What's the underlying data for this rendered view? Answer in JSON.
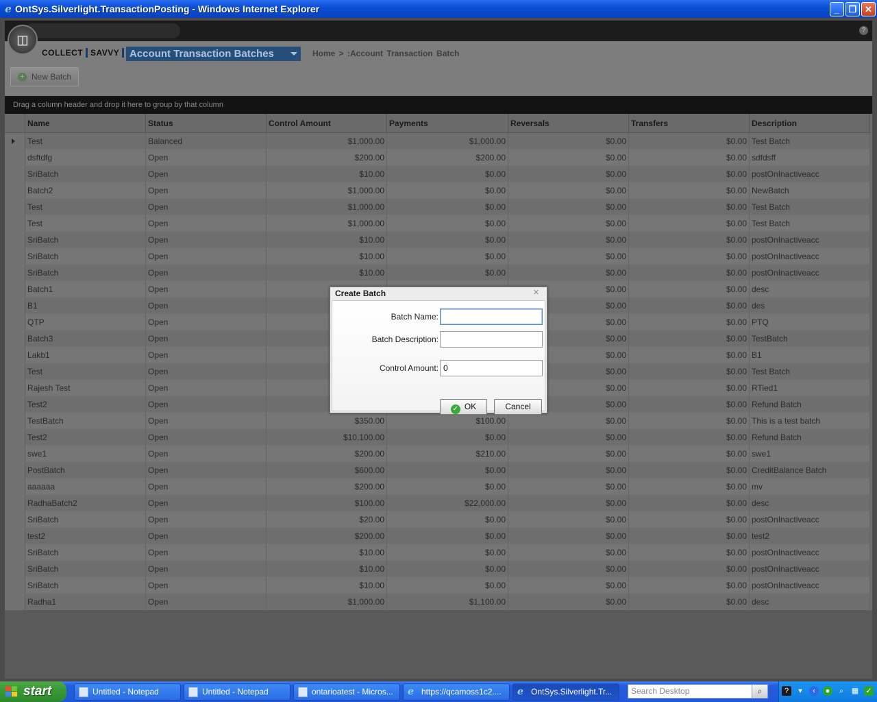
{
  "window": {
    "title": "OntSys.Silverlight.TransactionPosting - Windows Internet Explorer"
  },
  "app": {
    "brand_collect": "COLLECT",
    "brand_savvy": "SAVVY",
    "menu_title": "Account Transaction Batches",
    "breadcrumb": "Home  >  :Account Transaction Batch",
    "new_batch_label": "New Batch",
    "group_hint": "Drag a column header and drop it here to group by that column"
  },
  "grid": {
    "columns": [
      "Name",
      "Status",
      "Control Amount",
      "Payments",
      "Reversals",
      "Transfers",
      "Description"
    ],
    "rows": [
      [
        "Test",
        "Balanced",
        "$1,000.00",
        "$1,000.00",
        "$0.00",
        "$0.00",
        "Test Batch"
      ],
      [
        "dsftdfg",
        "Open",
        "$200.00",
        "$200.00",
        "$0.00",
        "$0.00",
        "sdfdsff"
      ],
      [
        "SriBatch",
        "Open",
        "$10.00",
        "$0.00",
        "$0.00",
        "$0.00",
        "postOnInactiveacc"
      ],
      [
        "Batch2",
        "Open",
        "$1,000.00",
        "$0.00",
        "$0.00",
        "$0.00",
        "NewBatch"
      ],
      [
        "Test",
        "Open",
        "$1,000.00",
        "$0.00",
        "$0.00",
        "$0.00",
        "Test Batch"
      ],
      [
        "Test",
        "Open",
        "$1,000.00",
        "$0.00",
        "$0.00",
        "$0.00",
        "Test Batch"
      ],
      [
        "SriBatch",
        "Open",
        "$10.00",
        "$0.00",
        "$0.00",
        "$0.00",
        "postOnInactiveacc"
      ],
      [
        "SriBatch",
        "Open",
        "$10.00",
        "$0.00",
        "$0.00",
        "$0.00",
        "postOnInactiveacc"
      ],
      [
        "SriBatch",
        "Open",
        "$10.00",
        "$0.00",
        "$0.00",
        "$0.00",
        "postOnInactiveacc"
      ],
      [
        "Batch1",
        "Open",
        "",
        "",
        "$0.00",
        "$0.00",
        "desc"
      ],
      [
        "B1",
        "Open",
        "",
        "",
        "$0.00",
        "$0.00",
        "des"
      ],
      [
        "QTP",
        "Open",
        "",
        "",
        "$0.00",
        "$0.00",
        "PTQ"
      ],
      [
        "Batch3",
        "Open",
        "",
        "",
        "$0.00",
        "$0.00",
        "TestBatch"
      ],
      [
        "Lakb1",
        "Open",
        "",
        "",
        "$0.00",
        "$0.00",
        "B1"
      ],
      [
        "Test",
        "Open",
        "",
        "",
        "$0.00",
        "$0.00",
        "Test Batch"
      ],
      [
        "Rajesh Test",
        "Open",
        "",
        "",
        "$0.00",
        "$0.00",
        "RTied1"
      ],
      [
        "Test2",
        "Open",
        "",
        "",
        "$0.00",
        "$0.00",
        "Refund Batch"
      ],
      [
        "TestBatch",
        "Open",
        "$350.00",
        "$100.00",
        "$0.00",
        "$0.00",
        "This is a test batch"
      ],
      [
        "Test2",
        "Open",
        "$10,100.00",
        "$0.00",
        "$0.00",
        "$0.00",
        "Refund Batch"
      ],
      [
        "swe1",
        "Open",
        "$200.00",
        "$210.00",
        "$0.00",
        "$0.00",
        "swe1"
      ],
      [
        "PostBatch",
        "Open",
        "$600.00",
        "$0.00",
        "$0.00",
        "$0.00",
        "CreditBalance Batch"
      ],
      [
        "aaaaaa",
        "Open",
        "$200.00",
        "$0.00",
        "$0.00",
        "$0.00",
        "mv"
      ],
      [
        "RadhaBatch2",
        "Open",
        "$100.00",
        "$22,000.00",
        "$0.00",
        "$0.00",
        "desc"
      ],
      [
        "SriBatch",
        "Open",
        "$20.00",
        "$0.00",
        "$0.00",
        "$0.00",
        "postOnInactiveacc"
      ],
      [
        "test2",
        "Open",
        "$200.00",
        "$0.00",
        "$0.00",
        "$0.00",
        "test2"
      ],
      [
        "SriBatch",
        "Open",
        "$10.00",
        "$0.00",
        "$0.00",
        "$0.00",
        "postOnInactiveacc"
      ],
      [
        "SriBatch",
        "Open",
        "$10.00",
        "$0.00",
        "$0.00",
        "$0.00",
        "postOnInactiveacc"
      ],
      [
        "SriBatch",
        "Open",
        "$10.00",
        "$0.00",
        "$0.00",
        "$0.00",
        "postOnInactiveacc"
      ],
      [
        "Radha1",
        "Open",
        "$1,000.00",
        "$1,100.00",
        "$0.00",
        "$0.00",
        "desc"
      ]
    ]
  },
  "dialog": {
    "title": "Create Batch",
    "batch_name_label": "Batch Name:",
    "batch_name_value": "",
    "batch_desc_label": "Batch Description:",
    "batch_desc_value": "",
    "control_amount_label": "Control Amount:",
    "control_amount_value": "0",
    "ok_label": "OK",
    "cancel_label": "Cancel"
  },
  "taskbar": {
    "start_label": "start",
    "tasks": [
      {
        "label": "Untitled - Notepad",
        "icon": "notepad-icon"
      },
      {
        "label": "Untitled - Notepad",
        "icon": "notepad-icon"
      },
      {
        "label": "ontarioatest - Micros...",
        "icon": "sql-icon"
      },
      {
        "label": "https://qcamoss1c2....",
        "icon": "ie-icon"
      },
      {
        "label": "OntSys.Silverlight.Tr...",
        "icon": "ie-icon"
      }
    ],
    "search_placeholder": "Search Desktop"
  }
}
